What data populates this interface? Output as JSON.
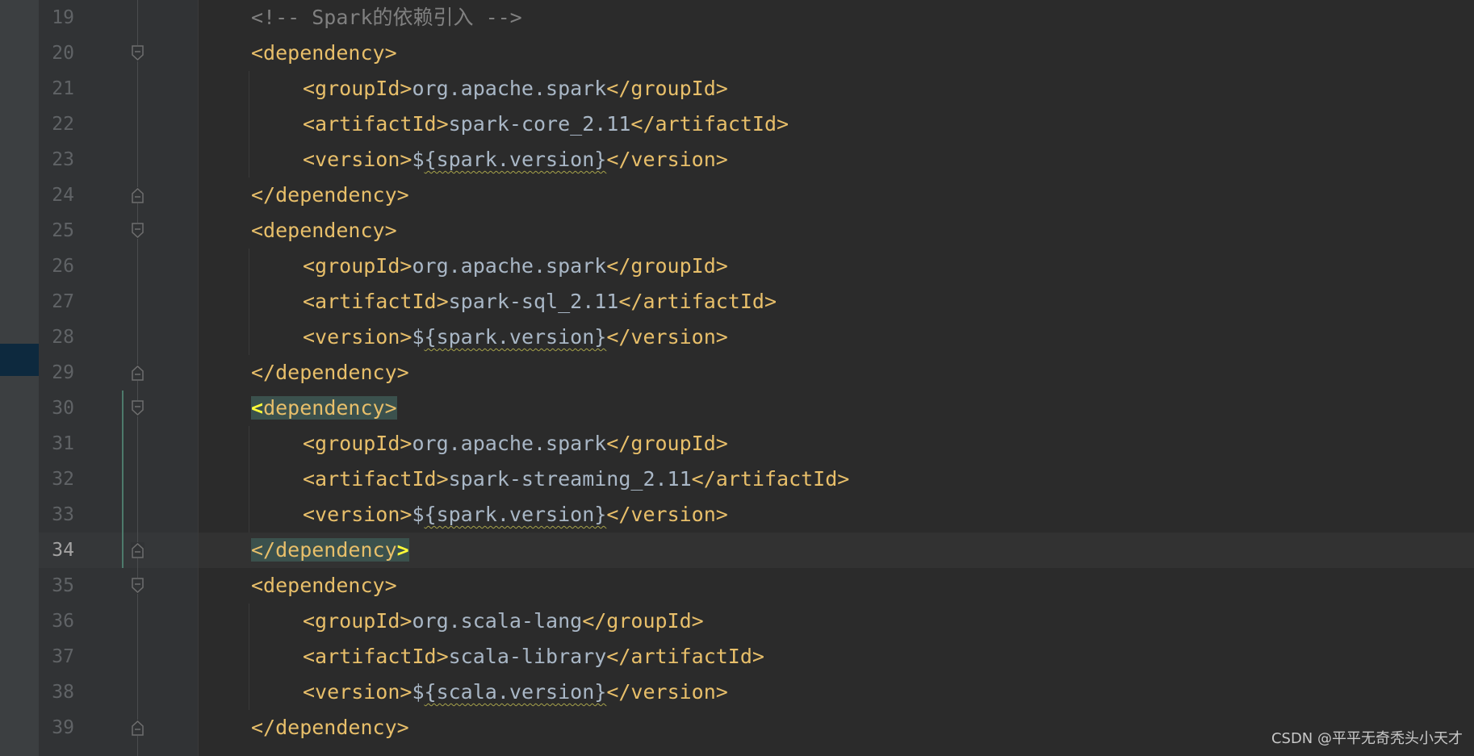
{
  "editor": {
    "current_line_number": "34",
    "lines": [
      {
        "n": "19",
        "comment": "<!-- Spark的依赖引入 -->"
      },
      {
        "n": "20",
        "open": "<dependency>"
      },
      {
        "n": "21",
        "t1": "<groupId>",
        "v": "org.apache.spark",
        "t2": "</groupId>"
      },
      {
        "n": "22",
        "t1": "<artifactId>",
        "v": "spark-core_2.11",
        "t2": "</artifactId>"
      },
      {
        "n": "23",
        "t1": "<version>",
        "d1": "$",
        "var": "{spark.version}",
        "t2": "</version>"
      },
      {
        "n": "24",
        "close": "</dependency>"
      },
      {
        "n": "25",
        "open": "<dependency>"
      },
      {
        "n": "26",
        "t1": "<groupId>",
        "v": "org.apache.spark",
        "t2": "</groupId>"
      },
      {
        "n": "27",
        "t1": "<artifactId>",
        "v": "spark-sql_2.11",
        "t2": "</artifactId>"
      },
      {
        "n": "28",
        "t1": "<version>",
        "d1": "$",
        "var": "{spark.version}",
        "t2": "</version>"
      },
      {
        "n": "29",
        "close": "</dependency>"
      },
      {
        "n": "30",
        "hl_lt": "<",
        "hl_rest": "dependency>"
      },
      {
        "n": "31",
        "t1": "<groupId>",
        "v": "org.apache.spark",
        "t2": "</groupId>"
      },
      {
        "n": "32",
        "t1": "<artifactId>",
        "v": "spark-streaming_2.11",
        "t2": "</artifactId>"
      },
      {
        "n": "33",
        "t1": "<version>",
        "d1": "$",
        "var": "{spark.version}",
        "t2": "</version>"
      },
      {
        "n": "34",
        "hlc_main": "</dependency",
        "hlc_gt": ">"
      },
      {
        "n": "35",
        "open": "<dependency>"
      },
      {
        "n": "36",
        "t1": "<groupId>",
        "v": "org.scala-lang",
        "t2": "</groupId>"
      },
      {
        "n": "37",
        "t1": "<artifactId>",
        "v": "scala-library",
        "t2": "</artifactId>"
      },
      {
        "n": "38",
        "t1": "<version>",
        "d1": "$",
        "var": "{scala.version}",
        "t2": "</version>"
      },
      {
        "n": "39",
        "close": "</dependency>"
      }
    ]
  },
  "watermark": "CSDN @平平无奇秃头小天才",
  "colors": {
    "background": "#2b2b2b",
    "gutter": "#313335",
    "tag": "#e8bf6a",
    "text": "#a9b7c6",
    "comment": "#808080",
    "match_highlight": "#3b514d",
    "brace_match": "#fefc38"
  },
  "icons": {
    "fold_open": "fold-open-icon",
    "fold_close": "fold-close-icon"
  }
}
